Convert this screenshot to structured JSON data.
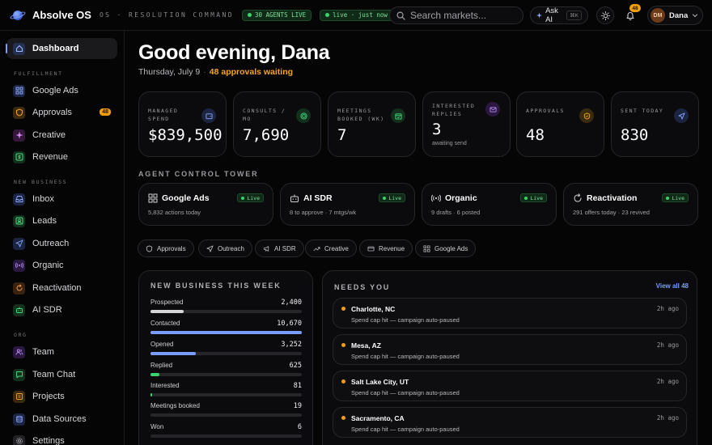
{
  "topbar": {
    "brand": "Absolve OS",
    "subtitle": "OS · RESOLUTION COMMAND",
    "agents_live": "30 AGENTS LIVE",
    "live_status": "live · just now",
    "search_placeholder": "Search markets...",
    "ask_ai": "Ask AI",
    "ask_ai_shortcut": "⌘K",
    "notifications_count": "48",
    "user_initials": "DM",
    "user_name": "Dana",
    "colors": {
      "accent": "#7a9cff",
      "live": "#39d46b",
      "warning": "#f59e0b"
    }
  },
  "sidebar": {
    "dashboard": "Dashboard",
    "sections": [
      "FULFILLMENT",
      "NEW BUSINESS",
      "ORG"
    ],
    "fulfillment": [
      {
        "label": "Google Ads",
        "icon": "grid-icon"
      },
      {
        "label": "Approvals",
        "icon": "shield-icon",
        "badge": "48"
      },
      {
        "label": "Creative",
        "icon": "sparkle-icon"
      },
      {
        "label": "Revenue",
        "icon": "dollar-icon"
      }
    ],
    "new_business": [
      {
        "label": "Inbox",
        "icon": "inbox-icon"
      },
      {
        "label": "Leads",
        "icon": "user-square-icon"
      },
      {
        "label": "Outreach",
        "icon": "send-icon"
      },
      {
        "label": "Organic",
        "icon": "broadcast-icon"
      },
      {
        "label": "Reactivation",
        "icon": "refresh-icon"
      },
      {
        "label": "AI SDR",
        "icon": "bot-icon"
      }
    ],
    "org": [
      {
        "label": "Team",
        "icon": "users-icon"
      },
      {
        "label": "Team Chat",
        "icon": "chat-icon"
      },
      {
        "label": "Projects",
        "icon": "folder-icon"
      },
      {
        "label": "Data Sources",
        "icon": "database-icon"
      },
      {
        "label": "Settings",
        "icon": "gear-icon"
      }
    ]
  },
  "header": {
    "greeting": "Good evening, Dana",
    "date": "Thursday, July 9",
    "approvals_waiting": "48 approvals waiting"
  },
  "kpis": [
    {
      "label": "MANAGED SPEND",
      "value": "$839,500",
      "icon": "wallet-icon"
    },
    {
      "label": "CONSULTS / MO",
      "value": "7,690",
      "icon": "target-icon"
    },
    {
      "label": "MEETINGS BOOKED (WK)",
      "value": "7",
      "icon": "calendar-icon"
    },
    {
      "label": "INTERESTED REPLIES",
      "value": "3",
      "note": "awaiting send",
      "icon": "mail-icon"
    },
    {
      "label": "APPROVALS",
      "value": "48",
      "icon": "shield-check-icon"
    },
    {
      "label": "SENT TODAY",
      "value": "830",
      "icon": "send-icon"
    }
  ],
  "tower": {
    "title": "AGENT CONTROL TOWER",
    "agents": [
      {
        "name": "Google Ads",
        "status": "Live",
        "desc": "5,832 actions today"
      },
      {
        "name": "AI SDR",
        "status": "Live",
        "desc": "8 to approve · 7 mtgs/wk"
      },
      {
        "name": "Organic",
        "status": "Live",
        "desc": "9 drafts · 6 posted"
      },
      {
        "name": "Reactivation",
        "status": "Live",
        "desc": "291 offers today · 23 revived"
      }
    ]
  },
  "chips": [
    "Approvals",
    "Outreach",
    "AI SDR",
    "Creative",
    "Revenue",
    "Google Ads"
  ],
  "funnel": {
    "title": "NEW BUSINESS THIS WEEK",
    "rows": [
      {
        "label": "Prospected",
        "value": "2,400",
        "fill": 0.22,
        "color": "#d6d6da"
      },
      {
        "label": "Contacted",
        "value": "10,670",
        "fill": 1.0,
        "color": "#7a9cff"
      },
      {
        "label": "Opened",
        "value": "3,252",
        "fill": 0.3,
        "color": "#7a9cff"
      },
      {
        "label": "Replied",
        "value": "625",
        "fill": 0.06,
        "color": "#39d46b"
      },
      {
        "label": "Interested",
        "value": "81",
        "fill": 0.01,
        "color": "#39d46b"
      },
      {
        "label": "Meetings booked",
        "value": "19",
        "fill": 0.0,
        "color": "#39d46b"
      },
      {
        "label": "Won",
        "value": "6",
        "fill": 0.0,
        "color": "#39d46b"
      }
    ]
  },
  "needs": {
    "title": "NEEDS YOU",
    "view_all": "View all 48",
    "items": [
      {
        "city": "Charlotte, NC",
        "desc": "Spend cap hit — campaign auto-paused",
        "time": "2h ago"
      },
      {
        "city": "Mesa, AZ",
        "desc": "Spend cap hit — campaign auto-paused",
        "time": "2h ago"
      },
      {
        "city": "Salt Lake City, UT",
        "desc": "Spend cap hit — campaign auto-paused",
        "time": "2h ago"
      },
      {
        "city": "Sacramento, CA",
        "desc": "Spend cap hit — campaign auto-paused",
        "time": "2h ago"
      }
    ]
  }
}
